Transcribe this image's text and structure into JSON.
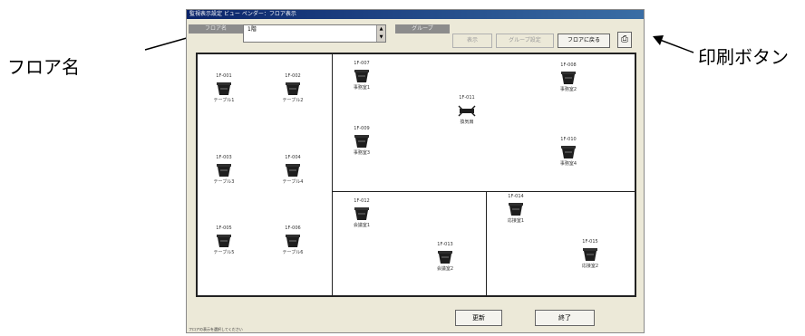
{
  "annotations": {
    "floor_label": "フロア名",
    "print_label": "印刷ボタン"
  },
  "window": {
    "title": "監視表示設定 ビュー ペンダー：フロア表示",
    "status_text": "フロアの表示を選択してください"
  },
  "toolbar": {
    "floor_label": "フロア名",
    "floor_value": "1階",
    "group_label": "グループ",
    "button_a": "表示",
    "button_b": "グループ設定",
    "button_c": "フロアに戻る",
    "print_icon": "printer-icon"
  },
  "footer": {
    "update_button": "更新",
    "close_button": "終了"
  },
  "units": [
    {
      "name": "1F-001",
      "label": "テーブル1"
    },
    {
      "name": "1F-002",
      "label": "テーブル2"
    },
    {
      "name": "1F-003",
      "label": "テーブル3"
    },
    {
      "name": "1F-004",
      "label": "テーブル4"
    },
    {
      "name": "1F-005",
      "label": "テーブル5"
    },
    {
      "name": "1F-006",
      "label": "テーブル6"
    },
    {
      "name": "1F-007",
      "label": "事務室1"
    },
    {
      "name": "1F-008",
      "label": "事務室2"
    },
    {
      "name": "1F-009",
      "label": "事務室3"
    },
    {
      "name": "1F-010",
      "label": "事務室4"
    },
    {
      "name": "1F-011",
      "label": "換気扇"
    },
    {
      "name": "1F-012",
      "label": "会議室1"
    },
    {
      "name": "1F-013",
      "label": "会議室2"
    },
    {
      "name": "1F-014",
      "label": "応接室1"
    },
    {
      "name": "1F-015",
      "label": "応接室2"
    }
  ]
}
